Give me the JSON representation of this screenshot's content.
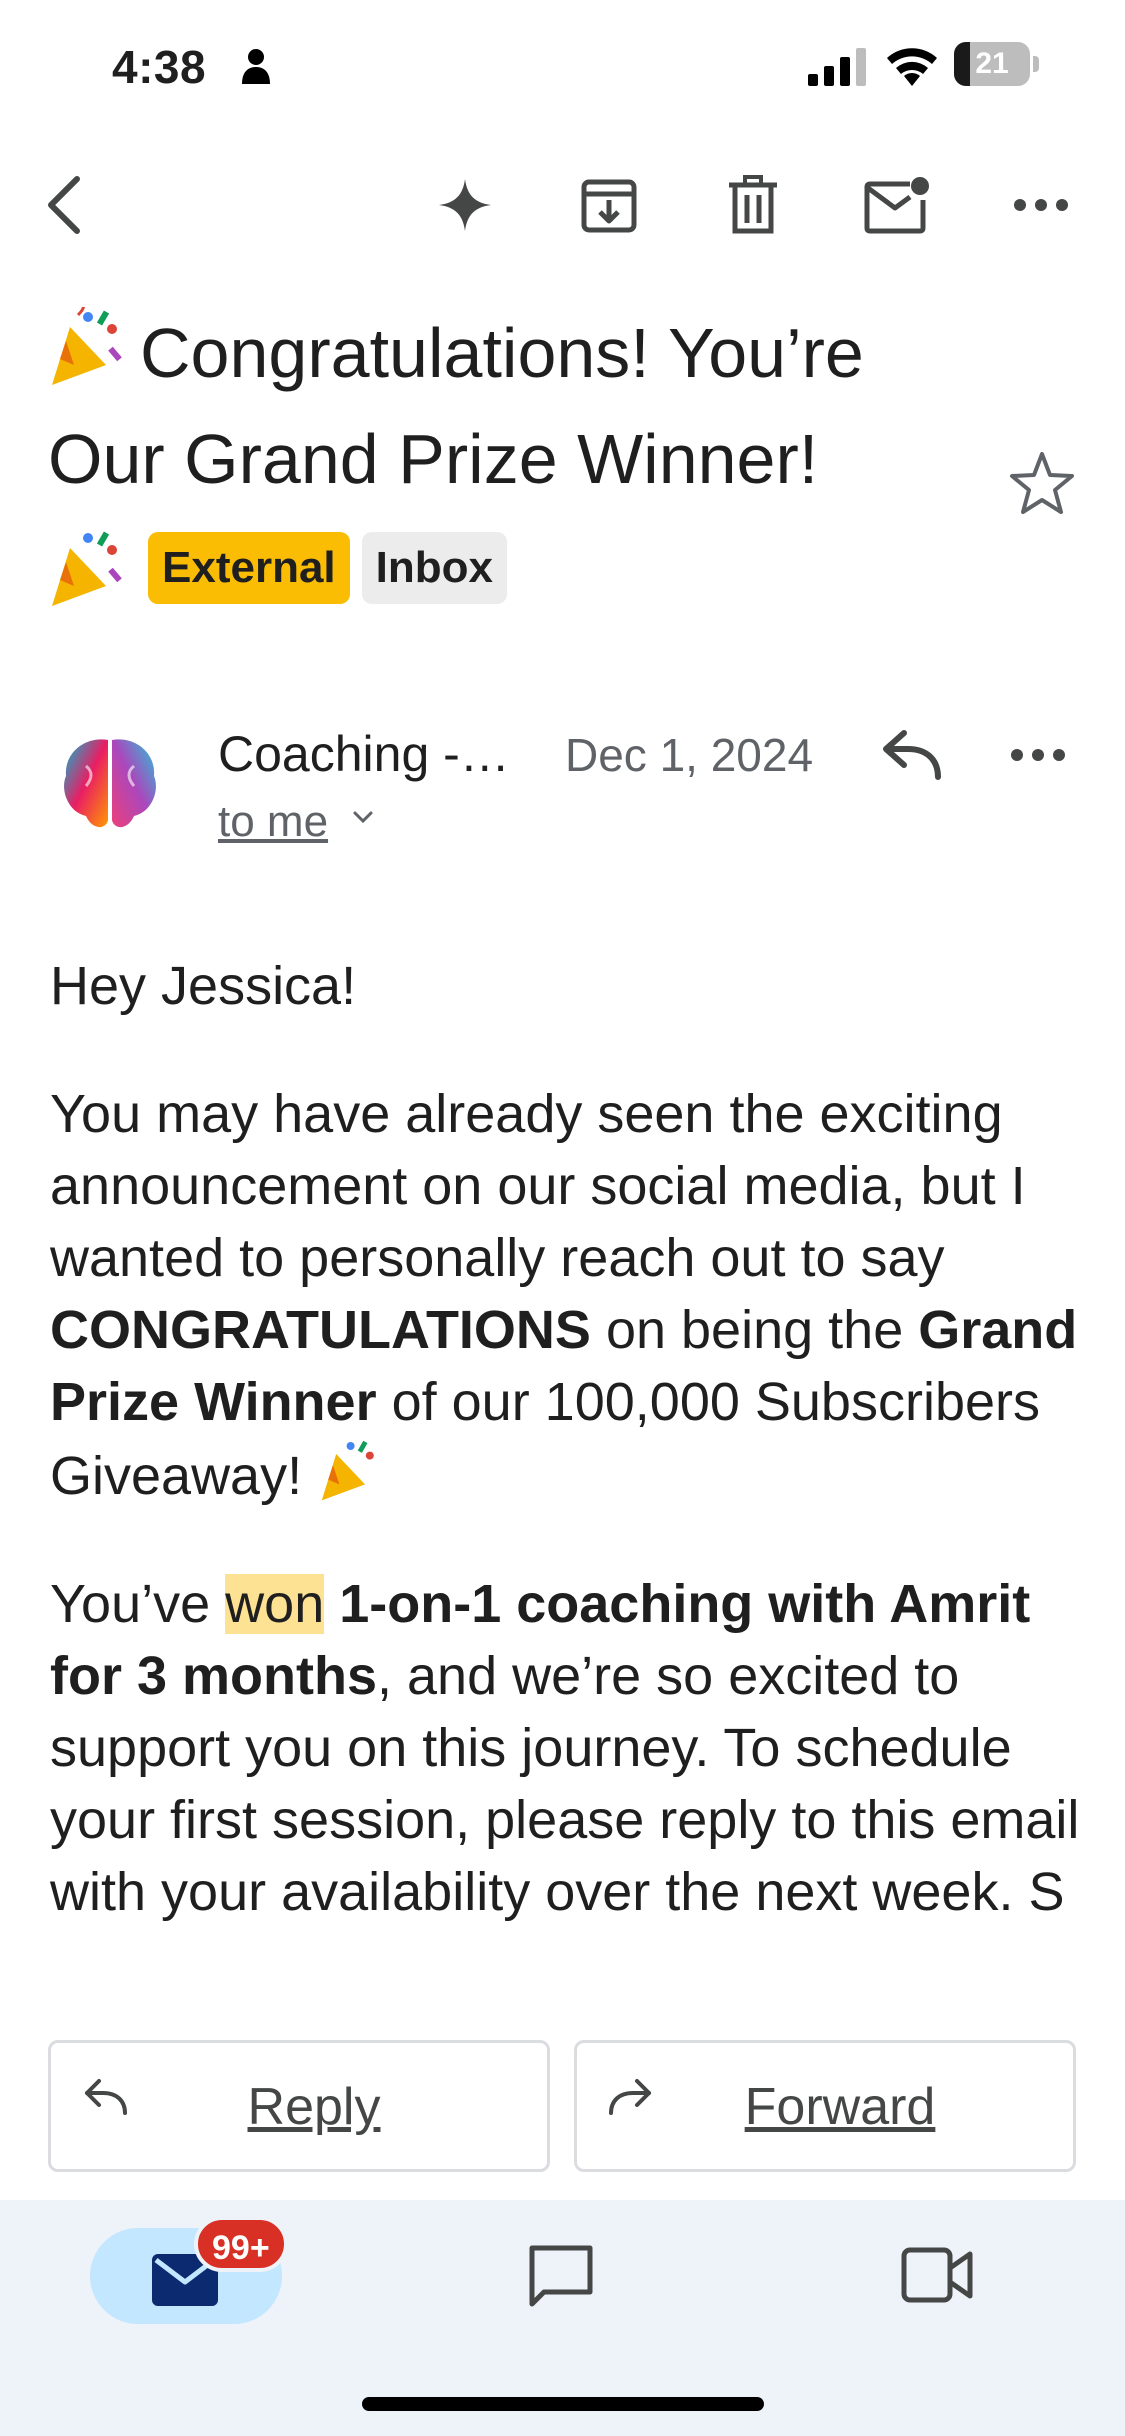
{
  "status_bar": {
    "time": "4:38",
    "battery": "21",
    "battery_level": 0.21
  },
  "toolbar": {
    "back_icon": "back-arrow-icon",
    "sparkle_icon": "sparkle-icon",
    "archive_icon": "archive-icon",
    "delete_icon": "trash-icon",
    "mark_unread_icon": "mark-unread-icon",
    "more_icon": "more-horizontal-icon"
  },
  "email": {
    "subject_line1": "Congratulations! You’re",
    "subject_line2": "Our Grand Prize Winner!",
    "labels": [
      "External",
      "Inbox"
    ],
    "sender": "Coaching -…",
    "date": "Dec 1, 2024",
    "recipient": "to me",
    "body": {
      "greeting": "Hey Jessica!",
      "p1_a": "You may have already seen the exciting announcement on our social media, but I wanted to personally reach out to say ",
      "p1_b": "CONGRATULATIONS",
      "p1_c": " on being the ",
      "p1_d": "Grand Prize Winner",
      "p1_e": " of our 100,000 Subscribers Giveaway! ",
      "p2_a": "You’ve ",
      "p2_b": "won",
      "p2_c": " ",
      "p2_d": "1-on-1 coaching with Amrit for 3 months",
      "p2_e": ", and we’re so excited to support you on this journey. To schedule your first session, please reply to this email with your availability over the next week. S"
    }
  },
  "actions": {
    "reply": "Reply",
    "forward": "Forward"
  },
  "bottom_nav": {
    "mail_badge": "99+",
    "items": [
      "mail-icon",
      "chat-icon",
      "meet-video-icon"
    ]
  },
  "colors": {
    "external_label": "#fbbc04",
    "inbox_label": "#ececec",
    "highlight": "#fde293",
    "badge": "#d93025",
    "nav_background": "#eef2f9",
    "active_nav_pill": "#c2e7ff"
  }
}
